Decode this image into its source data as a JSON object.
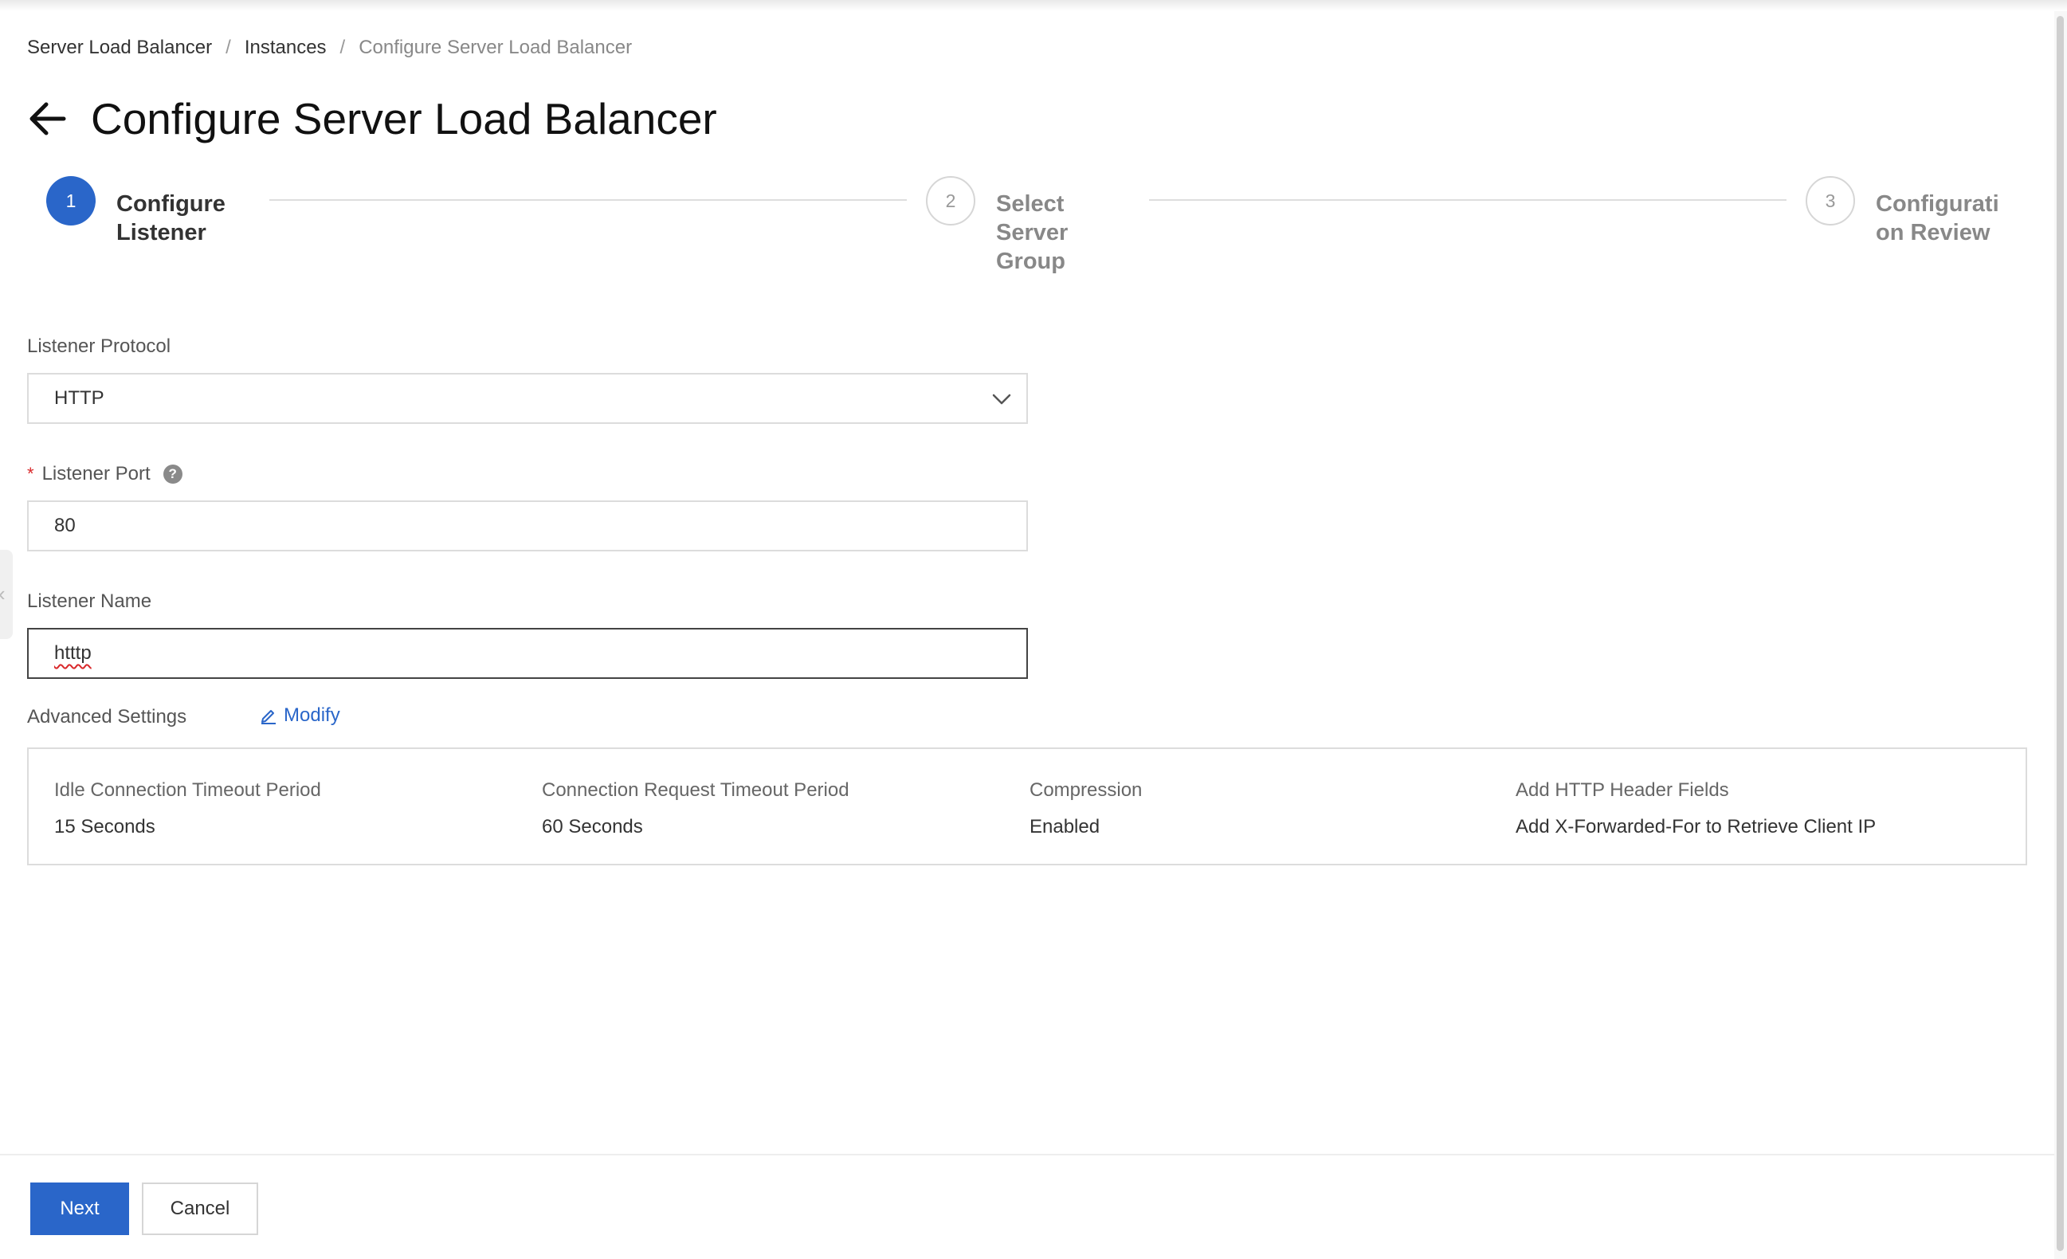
{
  "breadcrumb": {
    "items": [
      "Server Load Balancer",
      "Instances"
    ],
    "separator": "/",
    "current": "Configure Server Load Balancer"
  },
  "page": {
    "title": "Configure Server Load Balancer"
  },
  "steps": [
    {
      "number": "1",
      "label_line1": "Configure",
      "label_line2": "Listener",
      "label_line3": "",
      "status": "active"
    },
    {
      "number": "2",
      "label_line1": "Select",
      "label_line2": "Server",
      "label_line3": "Group",
      "status": "pending"
    },
    {
      "number": "3",
      "label_line1": "Configurati",
      "label_line2": "on Review",
      "label_line3": "",
      "status": "pending"
    }
  ],
  "form": {
    "protocol": {
      "label": "Listener Protocol",
      "value": "HTTP"
    },
    "port": {
      "label": "Listener Port",
      "required_mark": "*",
      "help": "?",
      "value": "80"
    },
    "name": {
      "label": "Listener Name",
      "value": "htttp"
    }
  },
  "advanced": {
    "label": "Advanced Settings",
    "modify_label": "Modify",
    "items": [
      {
        "key": "Idle Connection Timeout Period",
        "value": "15 Seconds"
      },
      {
        "key": "Connection Request Timeout Period",
        "value": "60 Seconds"
      },
      {
        "key": "Compression",
        "value": "Enabled"
      },
      {
        "key": "Add HTTP Header Fields",
        "value": "Add X-Forwarded-For to Retrieve Client IP"
      }
    ]
  },
  "footer": {
    "next_label": "Next",
    "cancel_label": "Cancel"
  },
  "colors": {
    "primary": "#2a66c9",
    "required": "#d9292b"
  },
  "icons": {
    "back": "arrow-left-icon",
    "help": "question-circle-icon",
    "select": "chevron-down-icon",
    "modify": "pencil-icon"
  }
}
